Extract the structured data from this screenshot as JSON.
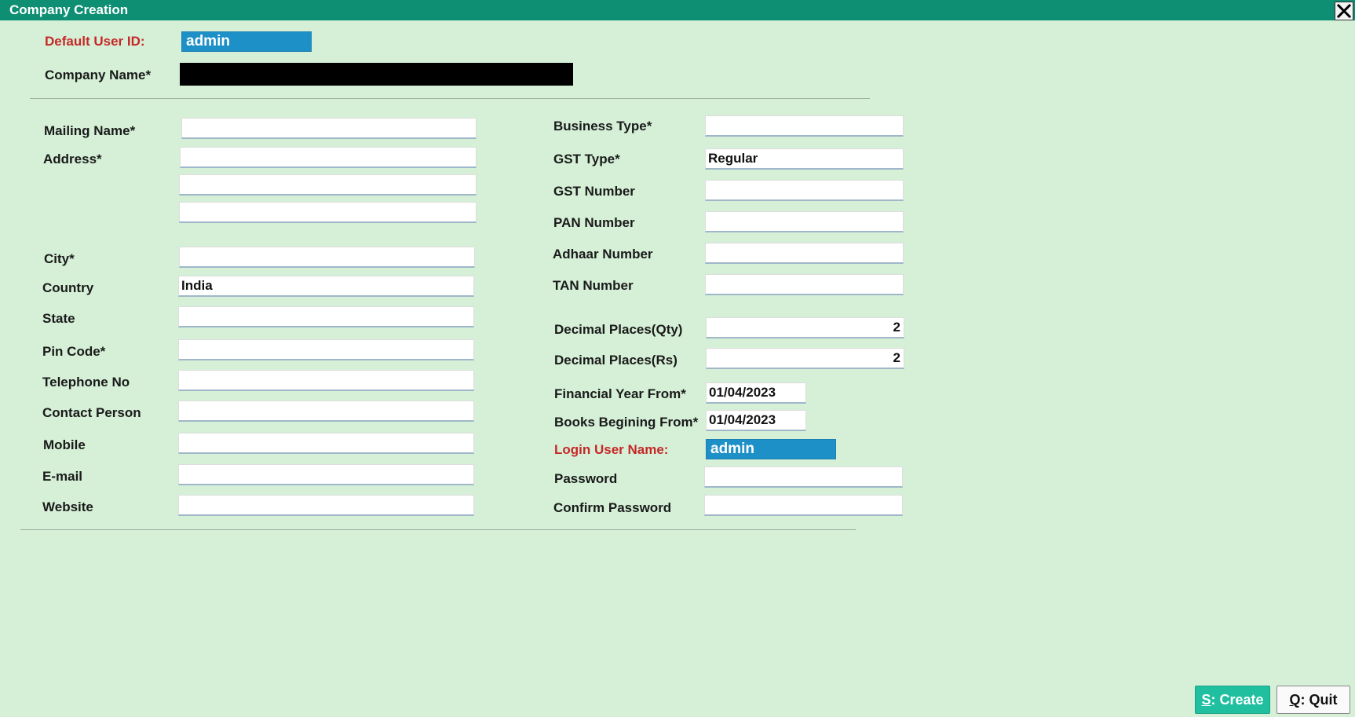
{
  "window": {
    "title": "Company Creation"
  },
  "header": {
    "default_user_id_label": "Default User ID:",
    "default_user_id_value": "admin",
    "company_name_label": "Company Name*",
    "company_name_value": ""
  },
  "left": {
    "mailing_name_label": "Mailing Name*",
    "address_label": "Address*",
    "city_label": "City*",
    "country_label": "Country",
    "country_value": "India",
    "state_label": "State",
    "pin_code_label": "Pin Code*",
    "telephone_label": "Telephone No",
    "contact_person_label": "Contact Person",
    "mobile_label": "Mobile",
    "email_label": "E-mail",
    "website_label": "Website"
  },
  "right": {
    "business_type_label": "Business Type*",
    "gst_type_label": "GST Type*",
    "gst_type_value": "Regular",
    "gst_number_label": "GST Number",
    "pan_number_label": "PAN Number",
    "adhaar_number_label": "Adhaar Number",
    "tan_number_label": "TAN Number",
    "decimal_qty_label": "Decimal Places(Qty)",
    "decimal_qty_value": "2",
    "decimal_rs_label": "Decimal Places(Rs)",
    "decimal_rs_value": "2",
    "fy_from_label": "Financial Year From*",
    "fy_from_value": "01/04/2023",
    "books_from_label": "Books Begining From*",
    "books_from_value": "01/04/2023",
    "login_user_label": "Login User Name:",
    "login_user_value": "admin",
    "password_label": "Password",
    "confirm_password_label": "Confirm Password"
  },
  "buttons": {
    "create_key": "S",
    "create_text": ": Create",
    "quit_key": "Q",
    "quit_text": ": Quit"
  },
  "colors": {
    "titlebar": "#0e8f74",
    "background": "#d5f0d7",
    "highlight_field": "#1e90c8",
    "required_label": "#c62828",
    "create_button": "#1fbf9f"
  }
}
